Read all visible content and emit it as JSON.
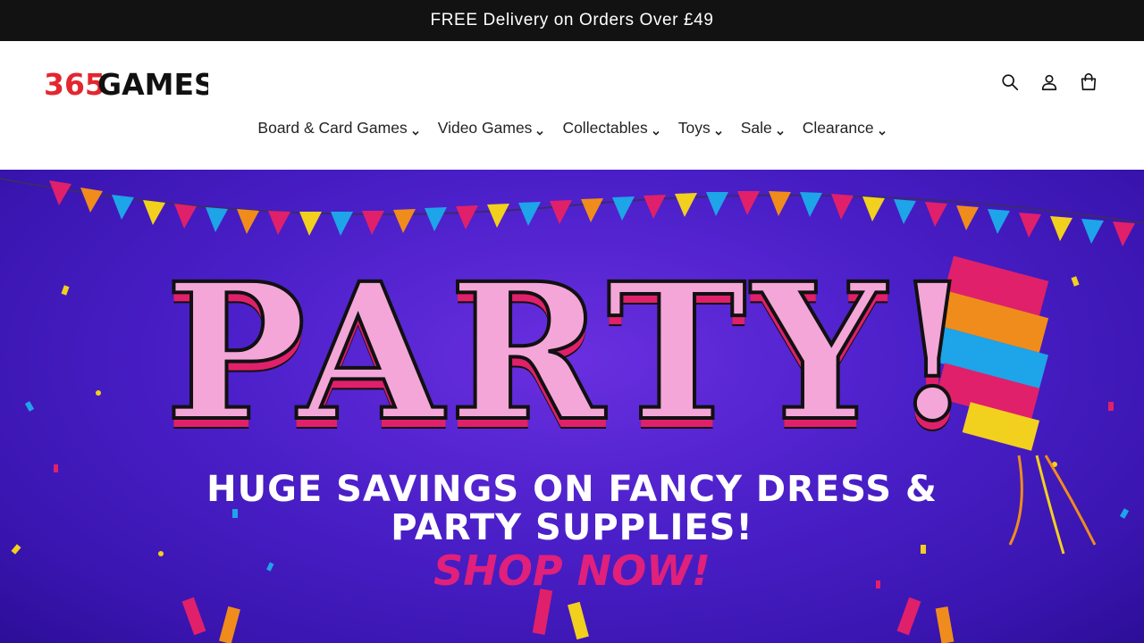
{
  "announcement": {
    "text": "FREE Delivery on Orders Over £49"
  },
  "header": {
    "logo": {
      "text_365": "365",
      "text_games": "GAMES",
      "accent": "#e3262f",
      "dark": "#111111"
    },
    "icons": [
      {
        "name": "search-icon"
      },
      {
        "name": "account-icon"
      },
      {
        "name": "cart-icon"
      }
    ]
  },
  "nav": {
    "items": [
      {
        "label": "Board & Card Games"
      },
      {
        "label": "Video Games"
      },
      {
        "label": "Collectables"
      },
      {
        "label": "Toys"
      },
      {
        "label": "Sale"
      },
      {
        "label": "Clearance"
      }
    ]
  },
  "hero": {
    "headline": "PARTY!",
    "line1": "HUGE SAVINGS ON FANCY DRESS &",
    "line2": "PARTY SUPPLIES!",
    "cta": "SHOP NOW!",
    "colors": {
      "background": "#4a1fc8",
      "headline_fill": "#f4a6d8",
      "cta": "#e0207a"
    }
  }
}
